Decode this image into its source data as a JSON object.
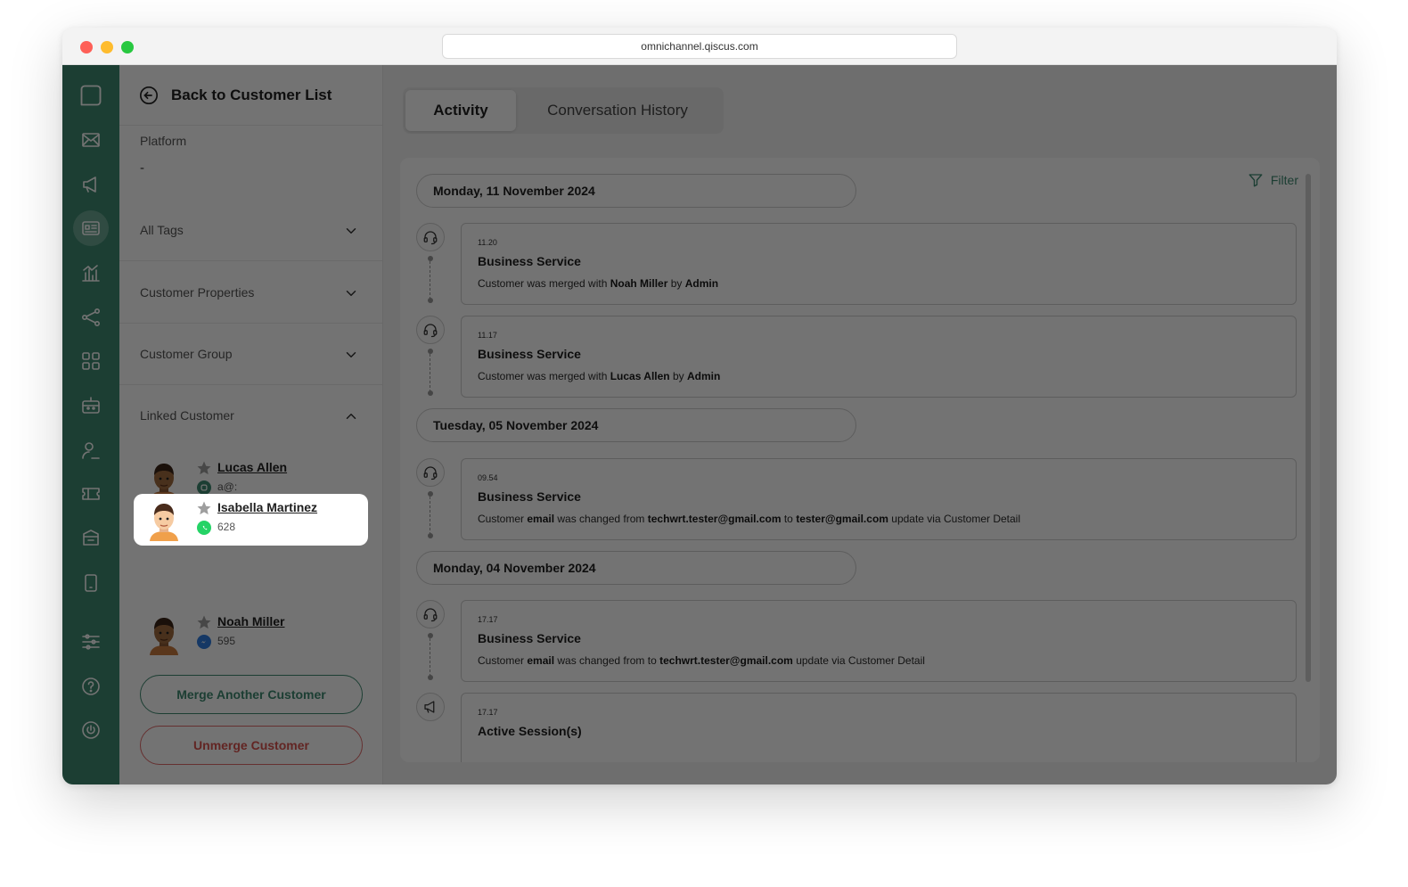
{
  "browser": {
    "url": "omnichannel.qiscus.com"
  },
  "nav": {
    "back_label": "Back to Customer List"
  },
  "customer": {
    "platform_label": "Platform",
    "platform_value": "-",
    "sections": [
      "All Tags",
      "Customer Properties",
      "Customer Group",
      "Linked Customer"
    ],
    "linked": [
      {
        "name": "Lucas Allen",
        "sub": "a@:",
        "channel": "qiscus-icon"
      },
      {
        "name": "Isabella Martinez",
        "sub": "628",
        "channel": "whatsapp-icon"
      },
      {
        "name": "Noah Miller",
        "sub": "595",
        "channel": "messenger-icon"
      }
    ],
    "merge_label": "Merge Another Customer",
    "unmerge_label": "Unmerge Customer"
  },
  "tabs": {
    "activity": "Activity",
    "history": "Conversation History"
  },
  "filter_label": "Filter",
  "timeline": {
    "d1": "Monday, 11 November 2024",
    "d2": "Tuesday, 05 November 2024",
    "d3": "Monday, 04 November 2024",
    "a1": {
      "time": "11.20",
      "title": "Business Service",
      "pre": "Customer was merged with ",
      "b1": "Noah Miller",
      "mid": " by ",
      "b2": "Admin"
    },
    "a2": {
      "time": "11.17",
      "title": "Business Service",
      "pre": "Customer was merged with ",
      "b1": "Lucas Allen",
      "mid": " by ",
      "b2": "Admin"
    },
    "a3": {
      "time": "09.54",
      "title": "Business Service",
      "p1": "Customer ",
      "b1": "email",
      "p2": " was changed from ",
      "b2": "techwrt.tester@gmail.com",
      "p3": " to ",
      "b3": "tester@gmail.com",
      "p4": " update via Customer Detail"
    },
    "a4": {
      "time": "17.17",
      "title": "Business Service",
      "p1": "Customer ",
      "b1": "email",
      "p2": " was changed from to ",
      "b2": "techwrt.tester@gmail.com",
      "p3": " update via Customer Detail"
    },
    "a5": {
      "time": "17.17",
      "title": "Active Session(s)"
    }
  },
  "colors": {
    "brand": "#3f8a71",
    "danger": "#d9534f"
  }
}
